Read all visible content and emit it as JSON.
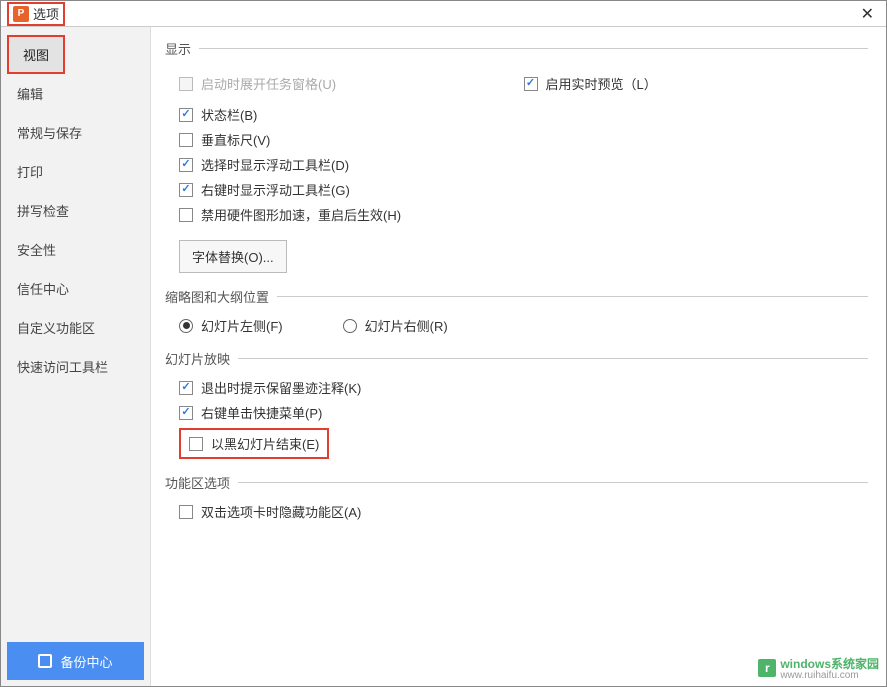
{
  "title": "选项",
  "sidebar": {
    "items": [
      {
        "label": "视图",
        "active": true
      },
      {
        "label": "编辑"
      },
      {
        "label": "常规与保存"
      },
      {
        "label": "打印"
      },
      {
        "label": "拼写检查"
      },
      {
        "label": "安全性"
      },
      {
        "label": "信任中心"
      },
      {
        "label": "自定义功能区"
      },
      {
        "label": "快速访问工具栏"
      }
    ],
    "backup": "备份中心"
  },
  "sections": {
    "display": {
      "title": "显示",
      "startupPane": "启动时展开任务窗格(U)",
      "livePreview": "启用实时预览（L）",
      "statusBar": "状态栏(B)",
      "verticalRuler": "垂直标尺(V)",
      "selectFloat": "选择时显示浮动工具栏(D)",
      "rightFloat": "右键时显示浮动工具栏(G)",
      "disableHW": "禁用硬件图形加速，重启后生效(H)",
      "fontSub": "字体替换(O)..."
    },
    "thumb": {
      "title": "缩略图和大纲位置",
      "left": "幻灯片左侧(F)",
      "right": "幻灯片右侧(R)"
    },
    "slideshow": {
      "title": "幻灯片放映",
      "inkPrompt": "退出时提示保留墨迹注释(K)",
      "rightMenu": "右键单击快捷菜单(P)",
      "endBlack": "以黑幻灯片结束(E)"
    },
    "ribbon": {
      "title": "功能区选项",
      "dblHide": "双击选项卡时隐藏功能区(A)"
    }
  },
  "watermark": {
    "brand": "windows系统家园",
    "url": "www.ruihaifu.com"
  }
}
